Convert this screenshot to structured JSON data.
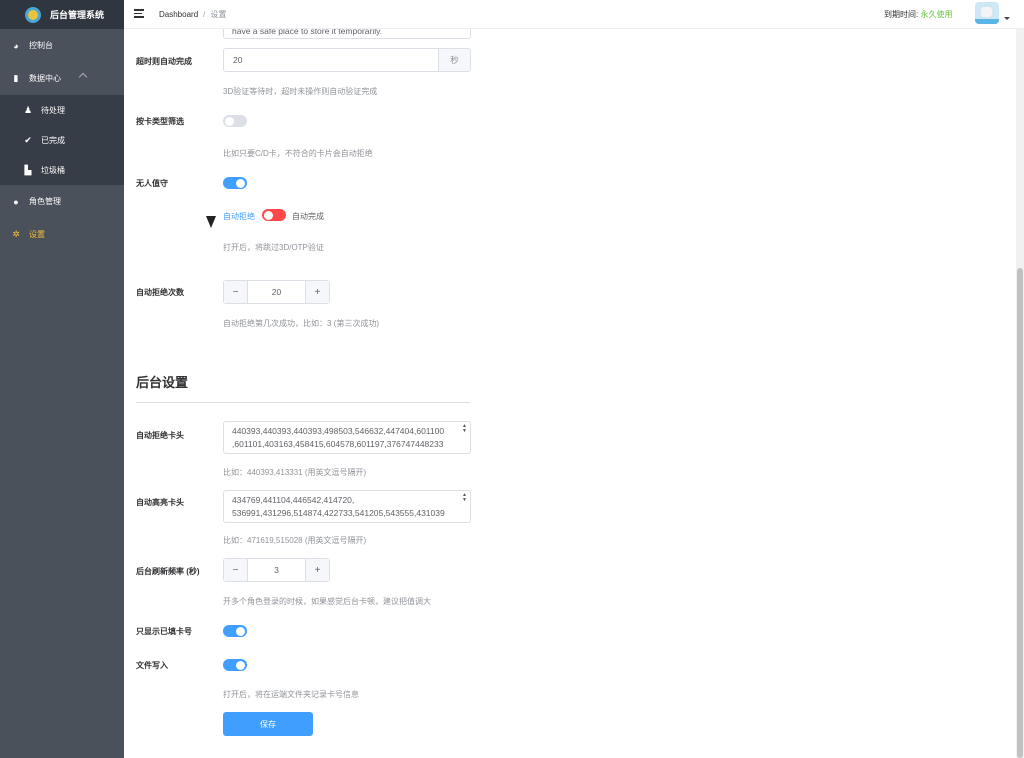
{
  "app": {
    "title": "后台管理系统"
  },
  "sidebar": {
    "items": [
      {
        "label": "控制台",
        "icon": "dashboard-icon"
      },
      {
        "label": "数据中心",
        "icon": "bar-chart-icon"
      },
      {
        "label": "待处理",
        "icon": "bell-icon"
      },
      {
        "label": "已完成",
        "icon": "check-circle-icon"
      },
      {
        "label": "垃圾桶",
        "icon": "trash-icon"
      },
      {
        "label": "角色管理",
        "icon": "user-icon"
      },
      {
        "label": "设置",
        "icon": "gear-icon"
      }
    ]
  },
  "header": {
    "breadcrumb_home": "Dashboard",
    "breadcrumb_sep": "/",
    "breadcrumb_current": "设置",
    "expire_label": "到期时间:",
    "expire_value": "永久使用"
  },
  "form": {
    "top_text": "have a safe place to store it temporarily.",
    "timeout_label": "超时则自动完成",
    "timeout_value": "20",
    "timeout_unit": "秒",
    "timeout_hint": "3D验证等待时，超时未操作则自动验证完成",
    "card_filter_label": "按卡类型筛选",
    "card_filter_hint": "比如只要C/D卡，不符合的卡片会自动拒绝",
    "unattended_label": "无人值守",
    "auto_reject_label": "自动拒绝",
    "auto_complete_label": "自动完成",
    "unattended_hint": "打开后，将跳过3D/OTP验证",
    "reject_count_label": "自动拒绝次数",
    "reject_count_value": "20",
    "reject_count_hint": "自动拒绝第几次成功，比如：3 (第三次成功)"
  },
  "backend": {
    "section_title": "后台设置",
    "reject_bins_label": "自动拒绝卡头",
    "reject_bins_line1": "440393,440393,440393,498503,546632,447404,601100",
    "reject_bins_line2": ",601101,403163,458415,604578,601197,376747448233",
    "reject_bins_hint": "比如：440393,413331 (用英文逗号隔开)",
    "highlight_bins_label": "自动高亮卡头",
    "highlight_bins_line1": "434769,441104,446542,414720,",
    "highlight_bins_line2": "536991,431296,514874,422733,541205,543555,431039",
    "highlight_bins_hint": "比如：471619,515028 (用英文逗号隔开)",
    "refresh_label": "后台刷新频率 (秒)",
    "refresh_value": "3",
    "refresh_hint": "开多个角色登录的时候，如果感觉后台卡顿，建议把值调大",
    "filled_only_label": "只显示已填卡号",
    "file_write_label": "文件写入",
    "file_write_hint": "打开后，将在运端文件夹记录卡号信息",
    "save_label": "保存",
    "minus": "−",
    "plus": "+"
  },
  "colors": {
    "primary": "#409eff",
    "sidebar": "#4a515b",
    "active": "#f5c038",
    "success": "#67c23a",
    "danger": "#ff4949"
  }
}
